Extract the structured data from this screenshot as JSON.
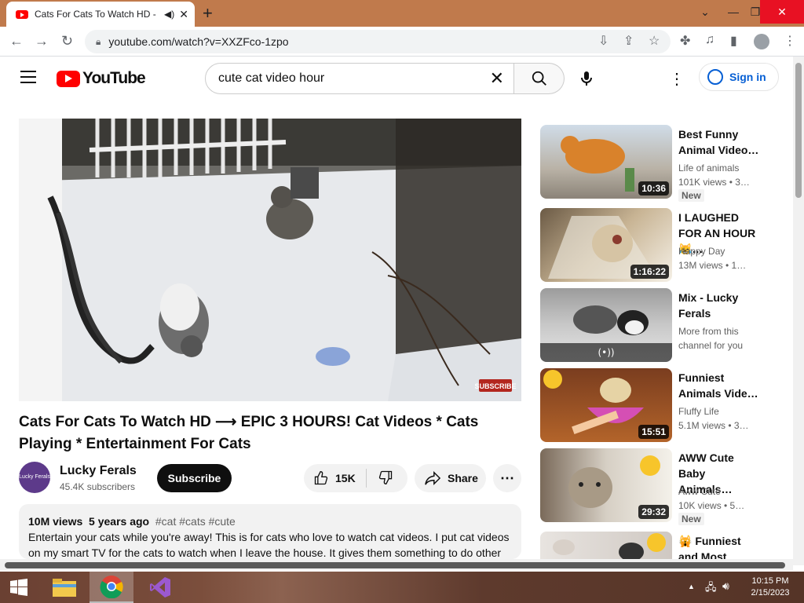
{
  "browser": {
    "tab_title": "Cats For Cats To Watch HD -",
    "url": "youtube.com/watch?v=XXZFco-1zpo"
  },
  "header": {
    "logo_text": "YouTube",
    "search_query": "cute cat video hour",
    "sign_in": "Sign in"
  },
  "video": {
    "title": "Cats For Cats To Watch HD ⟶ EPIC 3 HOURS! Cat Videos * Cats Playing * Entertainment For Cats",
    "watermark": "SUBSCRIBE",
    "channel_name": "Lucky Ferals",
    "channel_avatar_text": "Lucky Ferals",
    "subscribers": "45.4K subscribers",
    "subscribe_label": "Subscribe",
    "likes": "15K",
    "share_label": "Share",
    "views": "10M views",
    "age": "5 years ago",
    "tags": "#cat #cats #cute",
    "description": "Entertain your cats while you're away! This is for cats who love to watch cat videos. I put cat videos on my smart TV for the cats to watch when I leave the house. It gives them something to do other"
  },
  "recommendations": [
    {
      "title": "Best Funny Animal Video…",
      "channel": "Life of animals",
      "stats": "101K views  • 3…",
      "duration": "10:36",
      "badge": "New"
    },
    {
      "title": "I LAUGHED FOR AN HOUR😹…",
      "channel": "Happy Day",
      "stats": "13M views  • 1…",
      "duration": "1:16:22",
      "badge": ""
    },
    {
      "title": "Mix - Lucky Ferals",
      "channel": "More from this",
      "stats": "channel for you",
      "duration": "",
      "badge": ""
    },
    {
      "title": "Funniest Animals Vide…",
      "channel": "Fluffy Life",
      "stats": "5.1M views  • 3…",
      "duration": "15:51",
      "badge": ""
    },
    {
      "title": "AWW Cute Baby Animals…",
      "channel": "Aww Cute",
      "stats": "10K views  • 5…",
      "duration": "29:32",
      "badge": "New"
    },
    {
      "title": "🙀 Funniest and Most Hilariou…",
      "channel": "",
      "stats": "",
      "duration": "",
      "badge": ""
    }
  ],
  "taskbar": {
    "time": "10:15 PM",
    "date": "2/15/2023"
  }
}
